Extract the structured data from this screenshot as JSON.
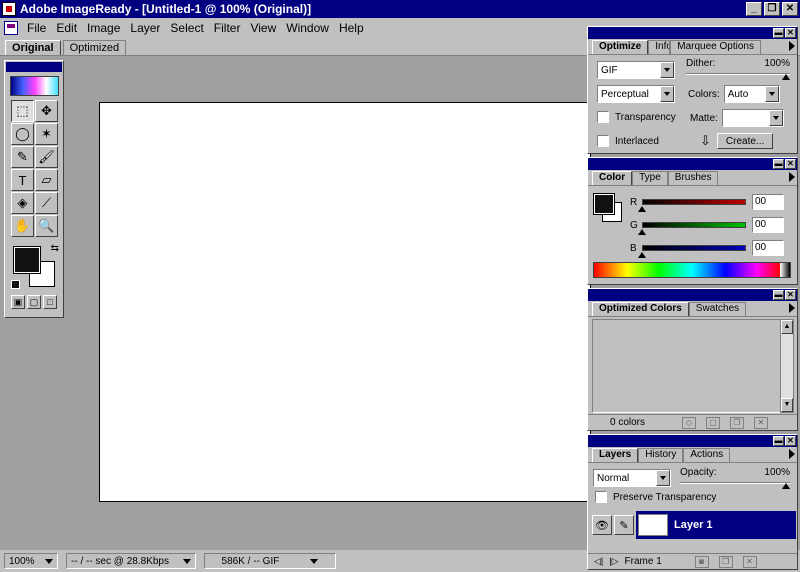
{
  "window": {
    "title": "Adobe ImageReady - [Untitled-1 @ 100% (Original)]",
    "controls": [
      "_",
      "❐",
      "✕"
    ]
  },
  "menu": [
    "File",
    "Edit",
    "Image",
    "Layer",
    "Select",
    "Filter",
    "View",
    "Window",
    "Help"
  ],
  "doc_tabs": [
    "Original",
    "Optimized"
  ],
  "status": {
    "zoom": "100%",
    "download": "-- / -- sec @ 28.8Kbps",
    "size": "586K / -- GIF"
  },
  "optimize_palette": {
    "tabs": [
      "Optimize",
      "Info",
      "Marquee Options"
    ],
    "format": "GIF",
    "dither_label": "Dither:",
    "dither_value": "100%",
    "palette": "Perceptual",
    "colors_label": "Colors:",
    "colors_value": "Auto",
    "transparency_label": "Transparency",
    "matte_label": "Matte:",
    "interlaced_label": "Interlaced",
    "create_button": "Create..."
  },
  "color_palette": {
    "tabs": [
      "Color",
      "Type",
      "Brushes"
    ],
    "channels": [
      {
        "label": "R",
        "value": "00",
        "color": "#c00000"
      },
      {
        "label": "G",
        "value": "00",
        "color": "#00c000"
      },
      {
        "label": "B",
        "value": "00",
        "color": "#0000c0"
      }
    ]
  },
  "optimized_colors_palette": {
    "tabs": [
      "Optimized Colors",
      "Swatches"
    ],
    "count": "0 colors"
  },
  "layers_palette": {
    "tabs": [
      "Layers",
      "History",
      "Actions"
    ],
    "blend_mode": "Normal",
    "opacity_label": "Opacity:",
    "opacity_value": "100%",
    "preserve_label": "Preserve Transparency",
    "layer_name": "Layer 1",
    "frame_label": "Frame 1"
  },
  "tools": [
    {
      "name": "marquee-tool-icon",
      "glyph": "⬚"
    },
    {
      "name": "move-tool-icon",
      "glyph": "✥"
    },
    {
      "name": "lasso-tool-icon",
      "glyph": "◯"
    },
    {
      "name": "magic-wand-tool-icon",
      "glyph": "✶"
    },
    {
      "name": "pencil-tool-icon",
      "glyph": "✎"
    },
    {
      "name": "brush-tool-icon",
      "glyph": "🖌"
    },
    {
      "name": "type-tool-icon",
      "glyph": "T"
    },
    {
      "name": "eraser-tool-icon",
      "glyph": "▱"
    },
    {
      "name": "paint-bucket-tool-icon",
      "glyph": "◈"
    },
    {
      "name": "eyedropper-tool-icon",
      "glyph": "⟋"
    },
    {
      "name": "hand-tool-icon",
      "glyph": "✋"
    },
    {
      "name": "zoom-tool-icon",
      "glyph": "🔍"
    }
  ]
}
